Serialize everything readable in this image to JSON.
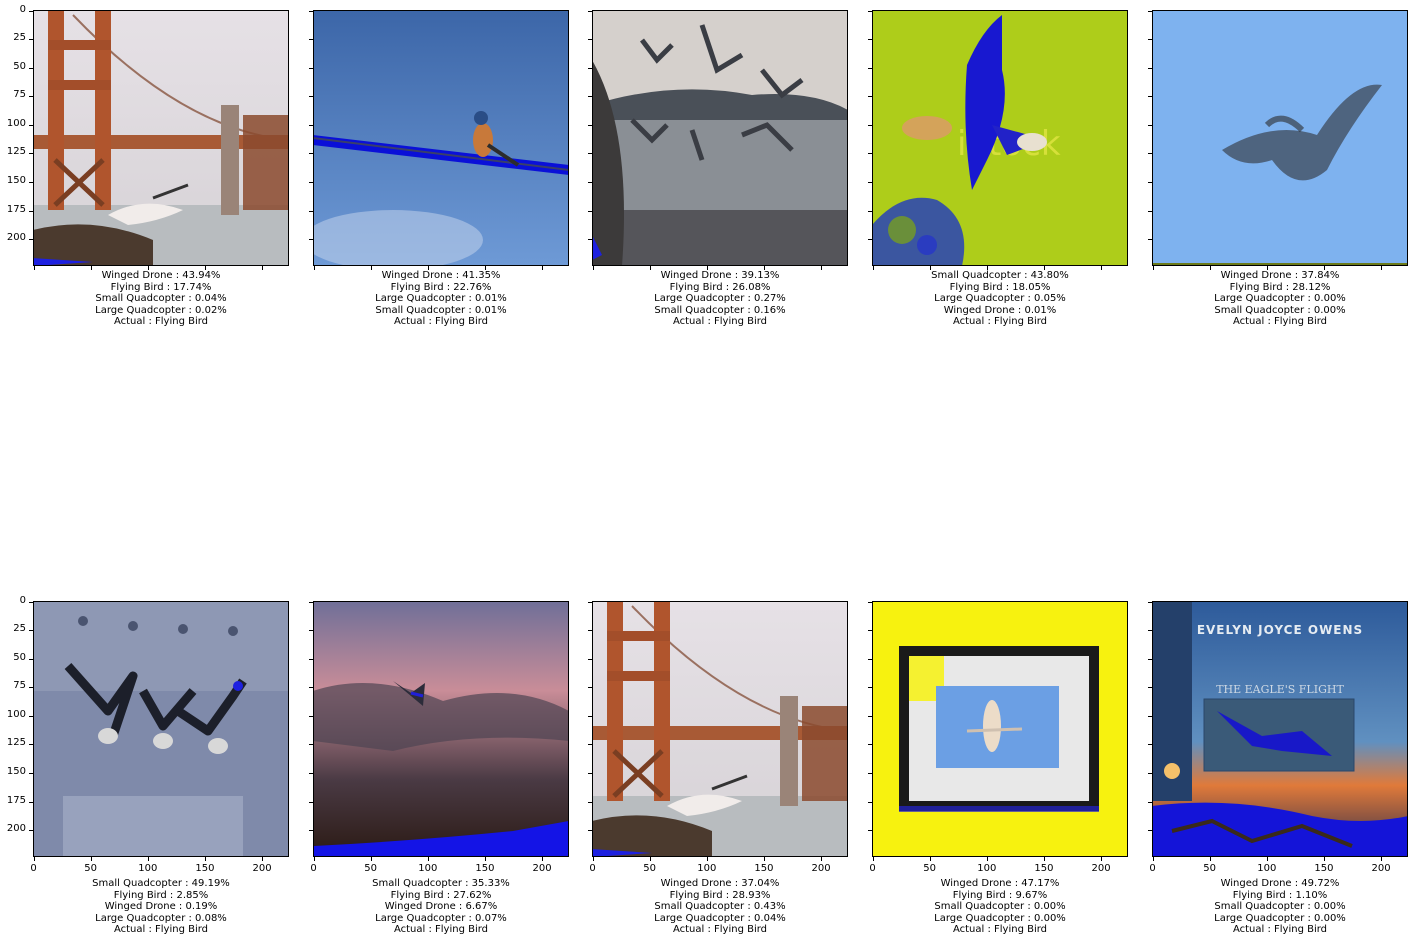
{
  "chart_data": {
    "type": "image-grid",
    "image_size": [
      224,
      224
    ],
    "y_ticks": [
      0,
      25,
      50,
      75,
      100,
      125,
      150,
      175,
      200
    ],
    "x_ticks": [
      0,
      50,
      100,
      150,
      200
    ],
    "panels": [
      {
        "scene": "bridge-gull",
        "predictions": [
          "Winged Drone : 43.94%",
          "Flying Bird : 17.74%",
          "Small Quadcopter : 0.04%",
          "Large Quadcopter : 0.02%"
        ],
        "actual": "Actual : Flying Bird"
      },
      {
        "scene": "bird-on-cable",
        "predictions": [
          "Winged Drone : 41.35%",
          "Flying Bird : 22.76%",
          "Large Quadcopter : 0.01%",
          "Small Quadcopter : 0.01%"
        ],
        "actual": "Actual : Flying Bird"
      },
      {
        "scene": "gulls-over-bay",
        "predictions": [
          "Winged Drone : 39.13%",
          "Flying Bird : 26.08%",
          "Large Quadcopter : 0.27%",
          "Small Quadcopter : 0.16%"
        ],
        "actual": "Actual : Flying Bird"
      },
      {
        "scene": "eagle-green",
        "predictions": [
          "Small Quadcopter : 43.80%",
          "Flying Bird : 18.05%",
          "Large Quadcopter : 0.05%",
          "Winged Drone : 0.01%"
        ],
        "actual": "Actual : Flying Bird"
      },
      {
        "scene": "blurred-bird",
        "predictions": [
          "Winged Drone : 37.84%",
          "Flying Bird : 28.12%",
          "Large Quadcopter : 0.00%",
          "Small Quadcopter : 0.00%"
        ],
        "actual": "Actual : Flying Bird"
      },
      {
        "scene": "geese-flock",
        "predictions": [
          "Small Quadcopter : 49.19%",
          "Flying Bird : 2.85%",
          "Winged Drone : 0.19%",
          "Large Quadcopter : 0.08%"
        ],
        "actual": "Actual : Flying Bird"
      },
      {
        "scene": "sunset-bird",
        "predictions": [
          "Small Quadcopter : 35.33%",
          "Flying Bird : 27.62%",
          "Winged Drone : 6.67%",
          "Large Quadcopter : 0.07%"
        ],
        "actual": "Actual : Flying Bird"
      },
      {
        "scene": "bridge-gull-2",
        "predictions": [
          "Winged Drone : 37.04%",
          "Flying Bird : 28.93%",
          "Small Quadcopter : 0.43%",
          "Large Quadcopter : 0.04%"
        ],
        "actual": "Actual : Flying Bird"
      },
      {
        "scene": "framed-heron",
        "predictions": [
          "Winged Drone : 47.17%",
          "Flying Bird : 9.67%",
          "Small Quadcopter : 0.00%",
          "Large Quadcopter : 0.00%"
        ],
        "actual": "Actual : Flying Bird"
      },
      {
        "scene": "book-cover-eagle",
        "overlay_text": [
          "EVELYN JOYCE OWENS",
          "THE EAGLE'S FLIGHT"
        ],
        "predictions": [
          "Winged Drone : 49.72%",
          "Flying Bird : 1.10%",
          "Small Quadcopter : 0.00%",
          "Large Quadcopter : 0.00%"
        ],
        "actual": "Actual : Flying Bird"
      }
    ],
    "y_tick_labels_visible_on_first_column_only": true,
    "x_tick_labels_visible_on_bottom_row_only": true
  }
}
